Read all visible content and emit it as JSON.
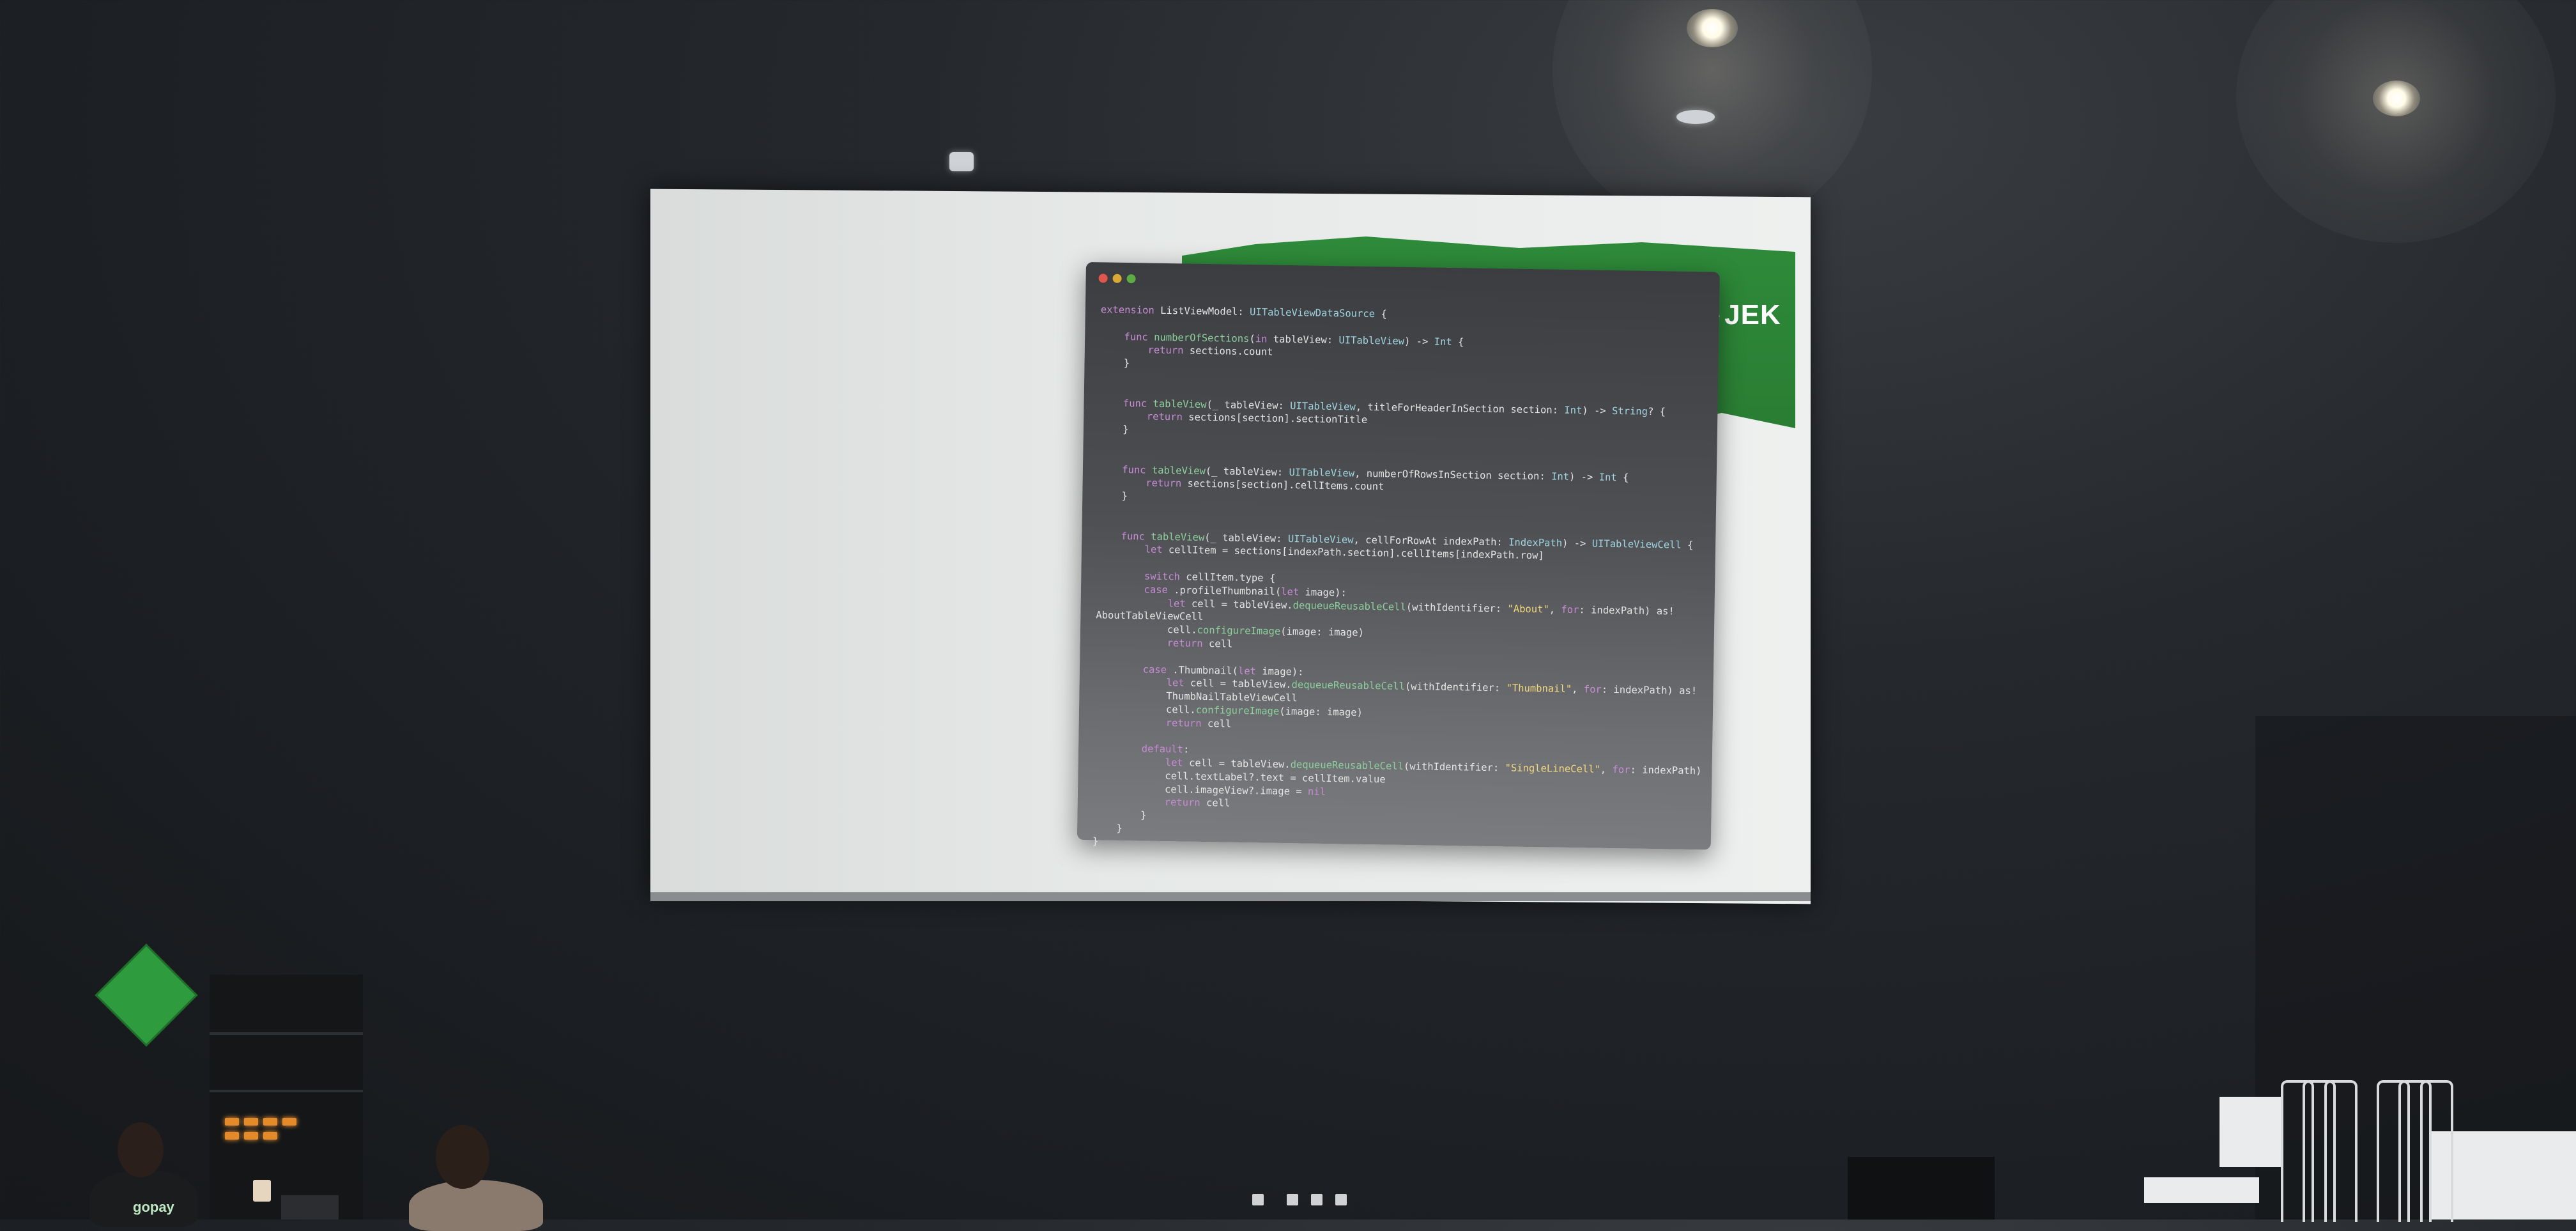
{
  "scene": {
    "description_colors": {
      "wall": "#1c1f23",
      "screen": "#e6e9e8",
      "brand_green": "#2e8b3a",
      "editor_bg": "#4f5054"
    }
  },
  "slide": {
    "brand_logo_text": "JEK",
    "code_lines": [
      "extension ListViewModel: UITableViewDataSource {",
      "",
      "    func numberOfSections(in tableView: UITableView) -> Int {",
      "        return sections.count",
      "    }",
      "",
      "",
      "    func tableView(_ tableView: UITableView, titleForHeaderInSection section: Int) -> String? {",
      "        return sections[section].sectionTitle",
      "    }",
      "",
      "",
      "    func tableView(_ tableView: UITableView, numberOfRowsInSection section: Int) -> Int {",
      "        return sections[section].cellItems.count",
      "    }",
      "",
      "",
      "    func tableView(_ tableView: UITableView, cellForRowAt indexPath: IndexPath) -> UITableViewCell {",
      "        let cellItem = sections[indexPath.section].cellItems[indexPath.row]",
      "",
      "        switch cellItem.type {",
      "        case .profileThumbnail(let image):",
      "            let cell = tableView.dequeueReusableCell(withIdentifier: \"About\", for: indexPath) as!",
      "AboutTableViewCell",
      "            cell.configureImage(image: image)",
      "            return cell",
      "",
      "        case .Thumbnail(let image):",
      "            let cell = tableView.dequeueReusableCell(withIdentifier: \"Thumbnail\", for: indexPath) as!",
      "            ThumbNailTableViewCell",
      "            cell.configureImage(image: image)",
      "            return cell",
      "",
      "        default:",
      "            let cell = tableView.dequeueReusableCell(withIdentifier: \"SingleLineCell\", for: indexPath)",
      "            cell.textLabel?.text = cellItem.value",
      "            cell.imageView?.image = nil",
      "            return cell",
      "        }",
      "    }",
      "}"
    ]
  },
  "audience": {
    "shirt_text": "gopay"
  }
}
